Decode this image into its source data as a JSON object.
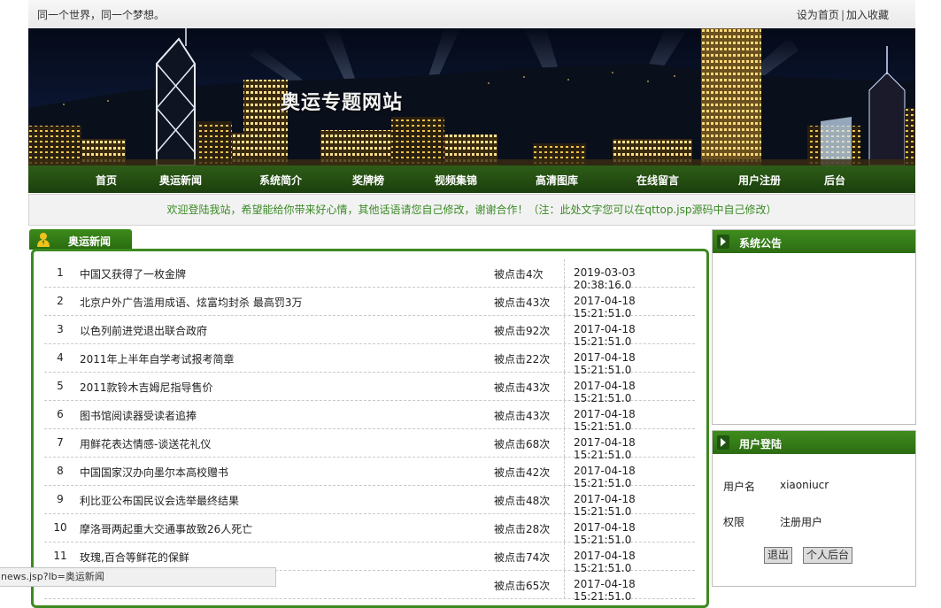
{
  "header": {
    "slogan": "同一个世界，同一个梦想。",
    "set_home": "设为首页",
    "separator": "|",
    "add_favorite": "加入收藏"
  },
  "banner": {
    "title": "奥运专题网站"
  },
  "nav": [
    {
      "label": "首页"
    },
    {
      "label": "奥运新闻"
    },
    {
      "label": "系统简介"
    },
    {
      "label": "奖牌榜"
    },
    {
      "label": "视频集锦"
    },
    {
      "label": "高清图库"
    },
    {
      "label": "在线留言"
    },
    {
      "label": "用户注册"
    },
    {
      "label": "后台"
    }
  ],
  "welcome": "欢迎登陆我站，希望能给你带来好心情，其他话语请您自己修改，谢谢合作！（注：此处文字您可以在qttop.jsp源码中自己修改）",
  "news": {
    "tab_title": "奥运新闻",
    "rows": [
      {
        "num": "1",
        "title": "中国又获得了一枚金牌",
        "hits": "被点击4次",
        "date": "2019-03-03 20:38:16.0"
      },
      {
        "num": "2",
        "title": "北京户外广告滥用成语、炫富均封杀 最高罚3万",
        "hits": "被点击43次",
        "date": "2017-04-18 15:21:51.0"
      },
      {
        "num": "3",
        "title": "以色列前进党退出联合政府",
        "hits": "被点击92次",
        "date": "2017-04-18 15:21:51.0"
      },
      {
        "num": "4",
        "title": "2011年上半年自学考试报考简章",
        "hits": "被点击22次",
        "date": "2017-04-18 15:21:51.0"
      },
      {
        "num": "5",
        "title": "2011款铃木吉姆尼指导售价",
        "hits": "被点击43次",
        "date": "2017-04-18 15:21:51.0"
      },
      {
        "num": "6",
        "title": "图书馆阅读器受读者追捧",
        "hits": "被点击43次",
        "date": "2017-04-18 15:21:51.0"
      },
      {
        "num": "7",
        "title": "用鲜花表达情感-谈送花礼仪",
        "hits": "被点击68次",
        "date": "2017-04-18 15:21:51.0"
      },
      {
        "num": "8",
        "title": "中国国家汉办向墨尔本高校赠书",
        "hits": "被点击42次",
        "date": "2017-04-18 15:21:51.0"
      },
      {
        "num": "9",
        "title": "利比亚公布国民议会选举最终结果",
        "hits": "被点击48次",
        "date": "2017-04-18 15:21:51.0"
      },
      {
        "num": "10",
        "title": "摩洛哥两起重大交通事故致26人死亡",
        "hits": "被点击28次",
        "date": "2017-04-18 15:21:51.0"
      },
      {
        "num": "11",
        "title": "玫瑰,百合等鲜花的保鲜",
        "hits": "被点击74次",
        "date": "2017-04-18 15:21:51.0"
      },
      {
        "num": "",
        "title": "",
        "hits": "被点击65次",
        "date": "2017-04-18 15:21:51.0"
      }
    ]
  },
  "announcement": {
    "title": "系统公告"
  },
  "login": {
    "title": "用户登陆",
    "username_label": "用户名",
    "username_value": "xiaoniucr",
    "role_label": "权限",
    "role_value": "注册用户",
    "logout_label": "退出",
    "personal_label": "个人后台"
  },
  "status_bar": "news.jsp?lb=奥运新闻",
  "colors": {
    "nav_green": "#1f4a10",
    "accent_green": "#3c8a1f",
    "welcome_text": "#3a8a25"
  }
}
